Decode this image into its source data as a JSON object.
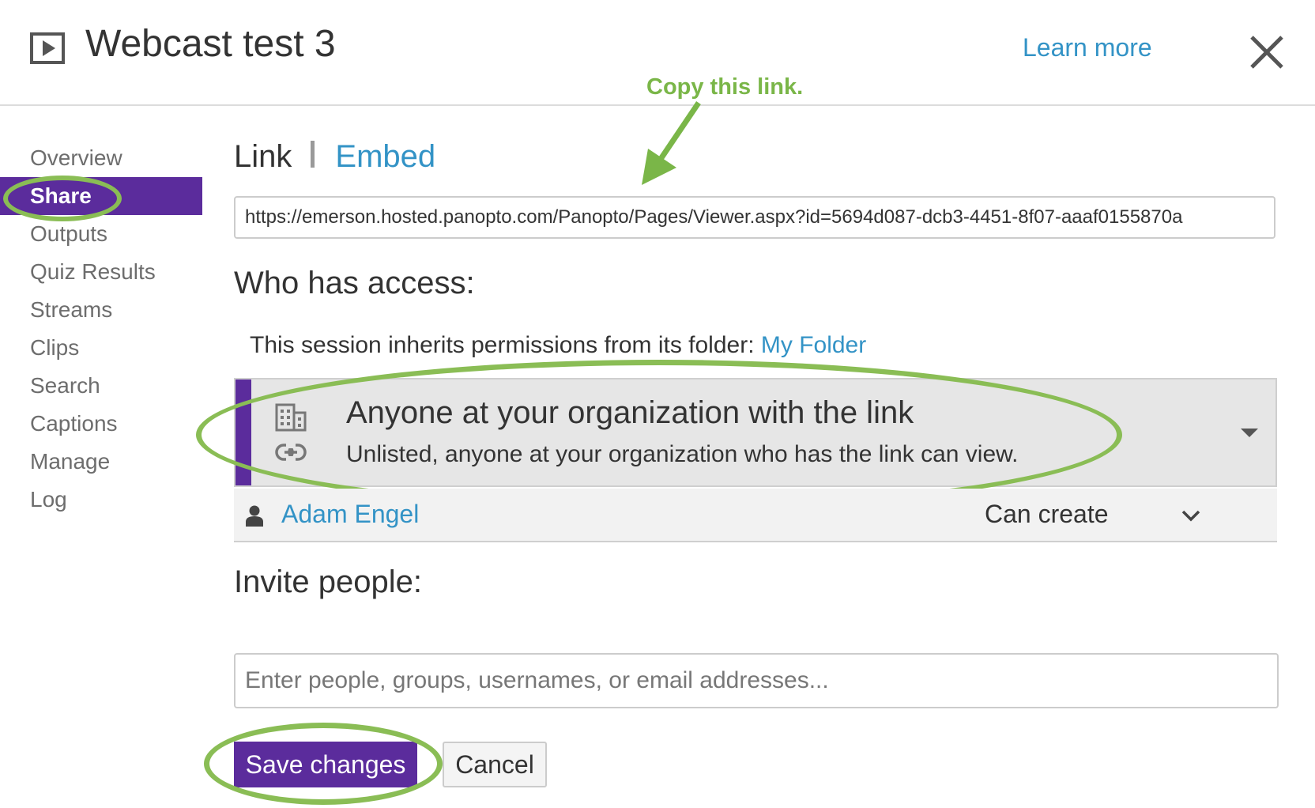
{
  "header": {
    "title": "Webcast test 3",
    "learn_more": "Learn more",
    "icon": "video-play-icon",
    "close_icon": "close-icon"
  },
  "annotations": {
    "copy_hint": "Copy this link.",
    "color": "#8abd55"
  },
  "sidebar": {
    "items": [
      {
        "label": "Overview",
        "active": false
      },
      {
        "label": "Share",
        "active": true
      },
      {
        "label": "Outputs",
        "active": false
      },
      {
        "label": "Quiz Results",
        "active": false
      },
      {
        "label": "Streams",
        "active": false
      },
      {
        "label": "Clips",
        "active": false
      },
      {
        "label": "Search",
        "active": false
      },
      {
        "label": "Captions",
        "active": false
      },
      {
        "label": "Manage",
        "active": false
      },
      {
        "label": "Log",
        "active": false
      }
    ]
  },
  "tabs": {
    "link": "Link",
    "embed": "Embed"
  },
  "share_link": {
    "url": "https://emerson.hosted.panopto.com/Panopto/Pages/Viewer.aspx?id=5694d087-dcb3-4451-8f07-aaaf0155870a"
  },
  "access": {
    "heading": "Who has access:",
    "inherit_text": "This session inherits permissions from its folder: ",
    "folder_name": "My Folder",
    "level_title": "Anyone at your organization with the link",
    "level_description": "Unlisted, anyone at your organization who has the link can view.",
    "icons": [
      "building-icon",
      "link-chain-icon",
      "caret-down-icon"
    ]
  },
  "users": [
    {
      "name": "Adam Engel",
      "role": "Can create",
      "icon": "person-icon"
    }
  ],
  "invite": {
    "heading": "Invite people:",
    "placeholder": "Enter people, groups, usernames, or email addresses..."
  },
  "buttons": {
    "save": "Save changes",
    "cancel": "Cancel"
  },
  "colors": {
    "accent_purple": "#5b2c9c",
    "link_blue": "#3393c6",
    "annotation_green": "#8abd55"
  }
}
